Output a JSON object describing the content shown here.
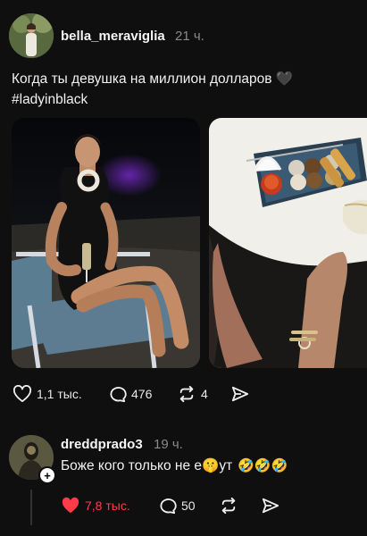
{
  "post": {
    "username": "bella_meraviglia",
    "time": "21 ч.",
    "text_line1": "Когда ты девушка на миллион долларов 🖤",
    "text_line2": "#ladyinblack",
    "actions": {
      "likes": "1,1 тыс.",
      "comments": "476",
      "reposts": "4"
    }
  },
  "reply": {
    "username": "dreddprado3",
    "time": "19 ч.",
    "text": "Боже кого только не е🤫ут",
    "emojis": "🤣🤣🤣",
    "actions": {
      "likes": "7,8 тыс.",
      "comments": "50"
    },
    "like_color": "#ff3b4a"
  },
  "icons": {
    "like": "heart-icon",
    "comment": "comment-bubble-icon",
    "repost": "repost-icon",
    "share": "send-icon"
  }
}
